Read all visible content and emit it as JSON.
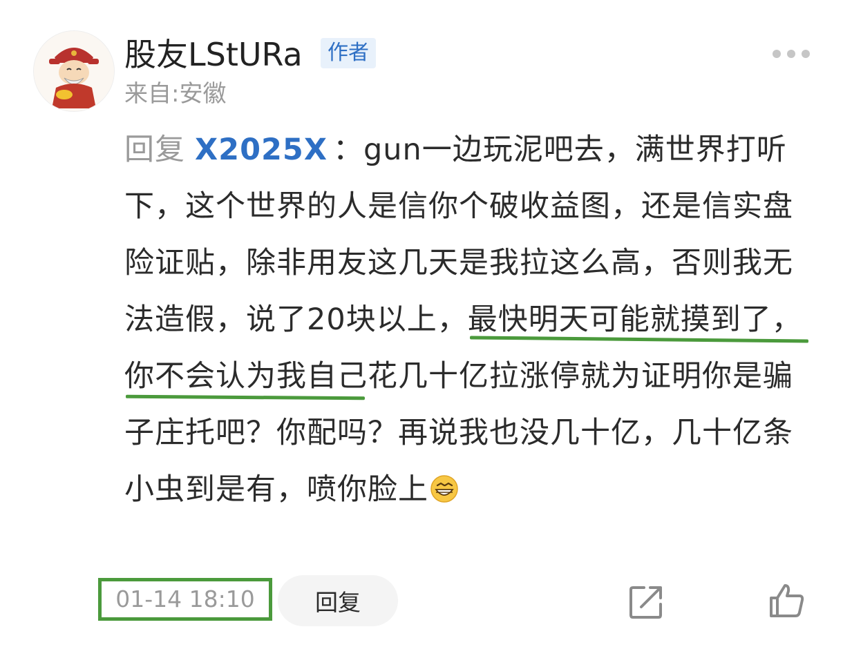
{
  "comment": {
    "username": "股友LStURa",
    "badge": "作者",
    "location": "来自:安徽",
    "reply_prefix": "回复",
    "reply_to": "X2025X",
    "body_text": "：gun一边玩泥吧去，满世界打听下，这个世界的人是信你个破收益图，还是信实盘险证贴，除非用友这几天是我拉这么高，否则我无法造假，说了20块以上，最快明天可能就摸到了，你不会认为我自己花几十亿拉涨停就为证明你是骗子庄托吧？你配吗？再说我也没几十亿，几十亿条小虫到是有，喷你脸上",
    "emoji_icon": "grinning-emoji",
    "timestamp": "01-14 18:10",
    "reply_button": "回复",
    "share_icon": "share-icon",
    "like_icon": "thumbs-up-icon",
    "more_icon": "more-dots-icon"
  },
  "colors": {
    "accent_blue": "#2e6fc4",
    "annotation_green": "#4b9a3c",
    "muted_gray": "#9a9a9a"
  }
}
